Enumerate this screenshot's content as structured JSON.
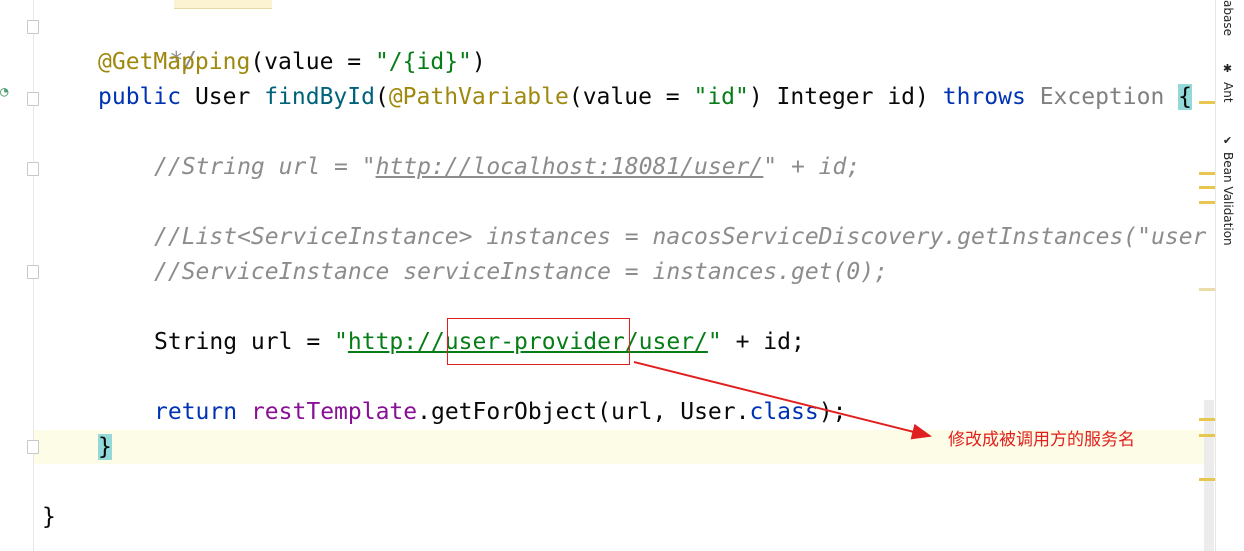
{
  "code": {
    "l1": "*/",
    "l2_ann": "@GetMapping",
    "l2_a": "(value = ",
    "l2_str": "\"/{id}\"",
    "l2_b": ")",
    "l3_kw": "public",
    "l3_a": " User ",
    "l3_fn": "findById",
    "l3_b": "(",
    "l3_ann": "@PathVariable",
    "l3_c": "(value = ",
    "l3_str": "\"id\"",
    "l3_d": ") Integer id) ",
    "l3_throws": "throws",
    "l3_e": " ",
    "l3_exc": "Exception",
    "l3_f": " ",
    "l3_brace": "{",
    "l4_a": "//String url = \"",
    "l4_url": "http://localhost:18081/user/",
    "l4_b": "\" + id;",
    "l5": "//List<ServiceInstance> instances = nacosServiceDiscovery.getInstances(\"user",
    "l6": "//ServiceInstance serviceInstance = instances.get(0);",
    "l7_a": "String url = ",
    "l7_q": "\"",
    "l7_url": "http://user-provider/user/",
    "l7_q2": "\"",
    "l7_b": " + id;",
    "l8_kw": "return",
    "l8_a": " ",
    "l8_fld": "restTemplate",
    "l8_b": ".getForObject(url, User.",
    "l8_kw2": "class",
    "l8_c": ");",
    "l9": "}",
    "l10": "}"
  },
  "annotation": {
    "text": "修改成被调用方的服务名"
  },
  "sidebar": {
    "database": "abase",
    "ant": "Ant",
    "bean_validation": "Bean Validation"
  },
  "colors": {
    "keyword": "#0033b3",
    "annotation": "#9e880d",
    "string": "#067d17",
    "comment": "#8c8c8c",
    "highlight": "#e02020"
  }
}
